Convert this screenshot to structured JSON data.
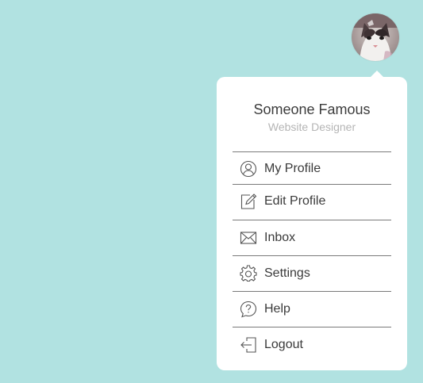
{
  "user": {
    "avatar_icon": "cat-avatar-photo",
    "name": "Someone Famous",
    "role": "Website Designer"
  },
  "menu": {
    "items": [
      {
        "label": "My Profile",
        "icon": "user-circle-icon"
      },
      {
        "label": "Edit Profile",
        "icon": "edit-icon"
      },
      {
        "label": "Inbox",
        "icon": "envelope-icon"
      },
      {
        "label": "Settings",
        "icon": "gear-icon"
      },
      {
        "label": "Help",
        "icon": "help-icon"
      },
      {
        "label": "Logout",
        "icon": "logout-icon"
      }
    ]
  },
  "colors": {
    "background": "#b1e2e1",
    "panel": "#ffffff",
    "divider": "#7a7a7a",
    "text": "#3a3a3a",
    "muted_text": "#b5b5b5"
  }
}
